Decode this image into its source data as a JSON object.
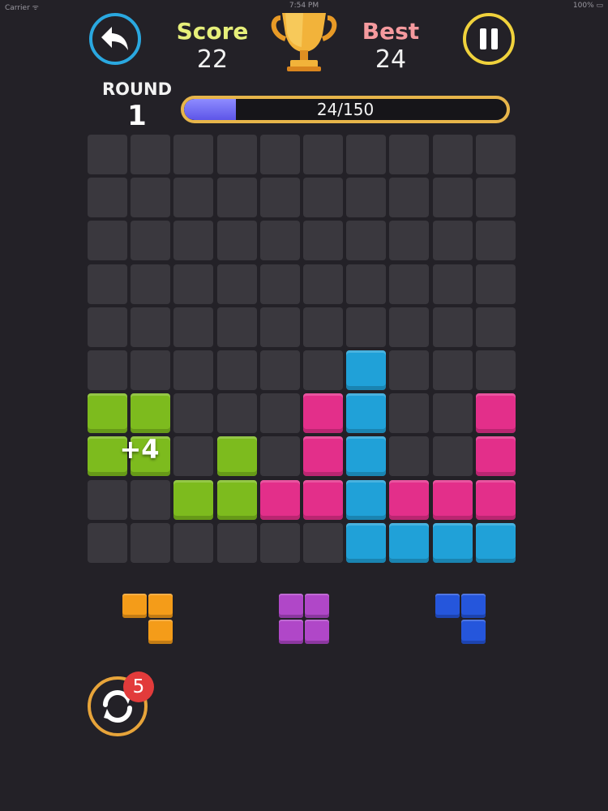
{
  "status_bar": {
    "carrier": "Carrier ᯤ",
    "time": "7:54 PM",
    "battery": "100% ▭"
  },
  "header": {
    "score_label": "Score",
    "score_value": "22",
    "best_label": "Best",
    "best_value": "24",
    "round_label": "ROUND",
    "round_value": "1",
    "progress_text": "24/150",
    "progress_fraction": 0.16,
    "score_color": "#e6ef7a",
    "best_color": "#f59a9e"
  },
  "icons": {
    "back": "back-arrow-icon",
    "pause": "pause-icon",
    "trophy": "trophy-icon",
    "refresh": "refresh-icon"
  },
  "colors": {
    "G": "#7dbb1e",
    "P": "#e32f8a",
    "B": "#20a1d8",
    "O": "#f49c19",
    "V": "#b047c8",
    "D": "#2556dc",
    "empty": "#3a383e"
  },
  "board": {
    "rows": [
      "..........",
      "..........",
      "..........",
      "..........",
      "..........",
      "......B...",
      "GG...PB..P",
      "GG.G.PB..P",
      "..GGPPBPPP",
      "......BBBB"
    ],
    "float_text": "+4"
  },
  "pieces": [
    {
      "color": "O",
      "cells": [
        [
          0,
          0
        ],
        [
          0,
          1
        ],
        [
          1,
          1
        ]
      ]
    },
    {
      "color": "V",
      "cells": [
        [
          0,
          0
        ],
        [
          0,
          1
        ],
        [
          1,
          0
        ],
        [
          1,
          1
        ]
      ]
    },
    {
      "color": "D",
      "cells": [
        [
          0,
          0
        ],
        [
          0,
          1
        ],
        [
          1,
          1
        ]
      ]
    }
  ],
  "refresh": {
    "badge": "5"
  }
}
